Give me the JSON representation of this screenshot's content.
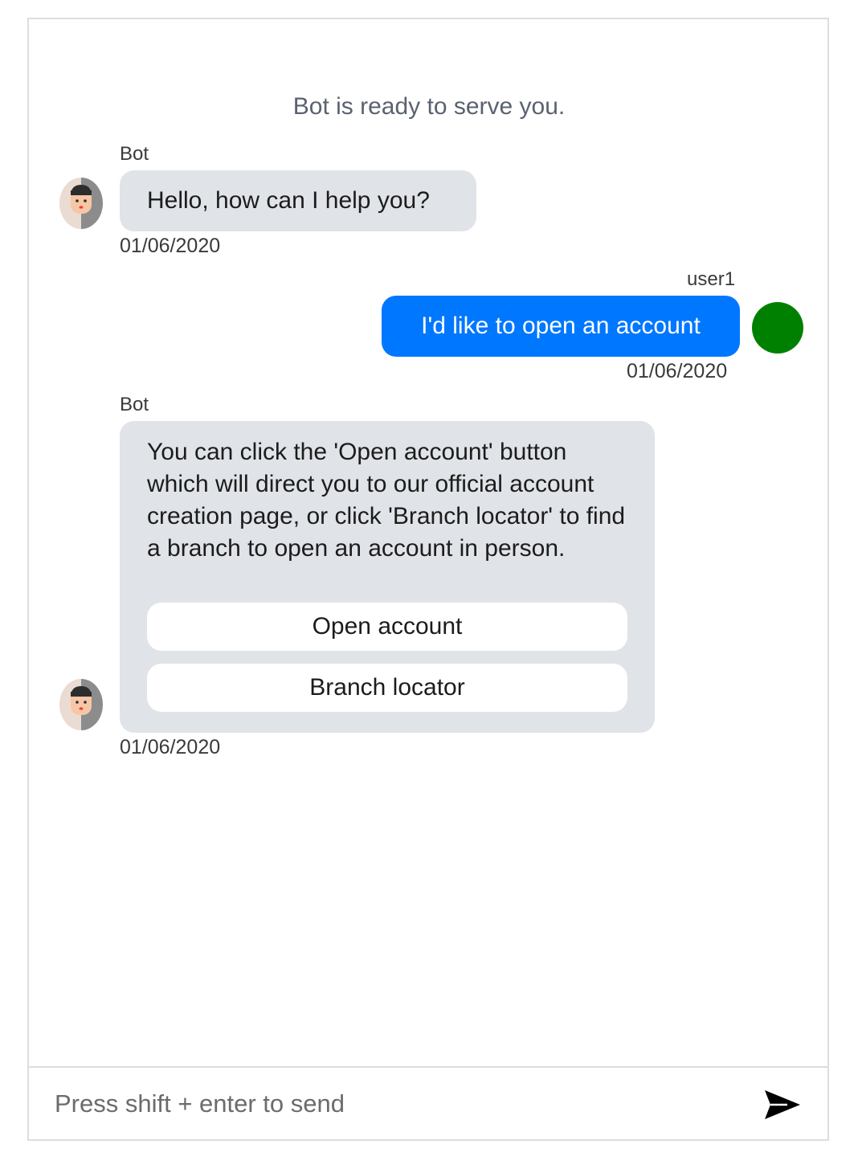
{
  "colors": {
    "user_bubble": "#0077ff",
    "bot_bubble": "#e0e3e7",
    "user_avatar": "#008000"
  },
  "status_text": "Bot is ready to serve you.",
  "messages": [
    {
      "sender": "Bot",
      "text": "Hello, how can I help you?",
      "timestamp": "01/06/2020",
      "avatar": "bot-face-icon"
    },
    {
      "sender": "user1",
      "text": "I'd like to open an account",
      "timestamp": "01/06/2020",
      "avatar": "user-avatar-circle"
    },
    {
      "sender": "Bot",
      "text": "You can click the 'Open account' button which will direct you to our official account creation page, or click 'Branch locator' to find a branch to open an account in person.",
      "timestamp": "01/06/2020",
      "avatar": "bot-face-icon",
      "buttons": [
        "Open account",
        "Branch locator"
      ]
    }
  ],
  "input": {
    "placeholder": "Press shift + enter to send",
    "value": ""
  },
  "send_icon": "send-arrow-icon"
}
